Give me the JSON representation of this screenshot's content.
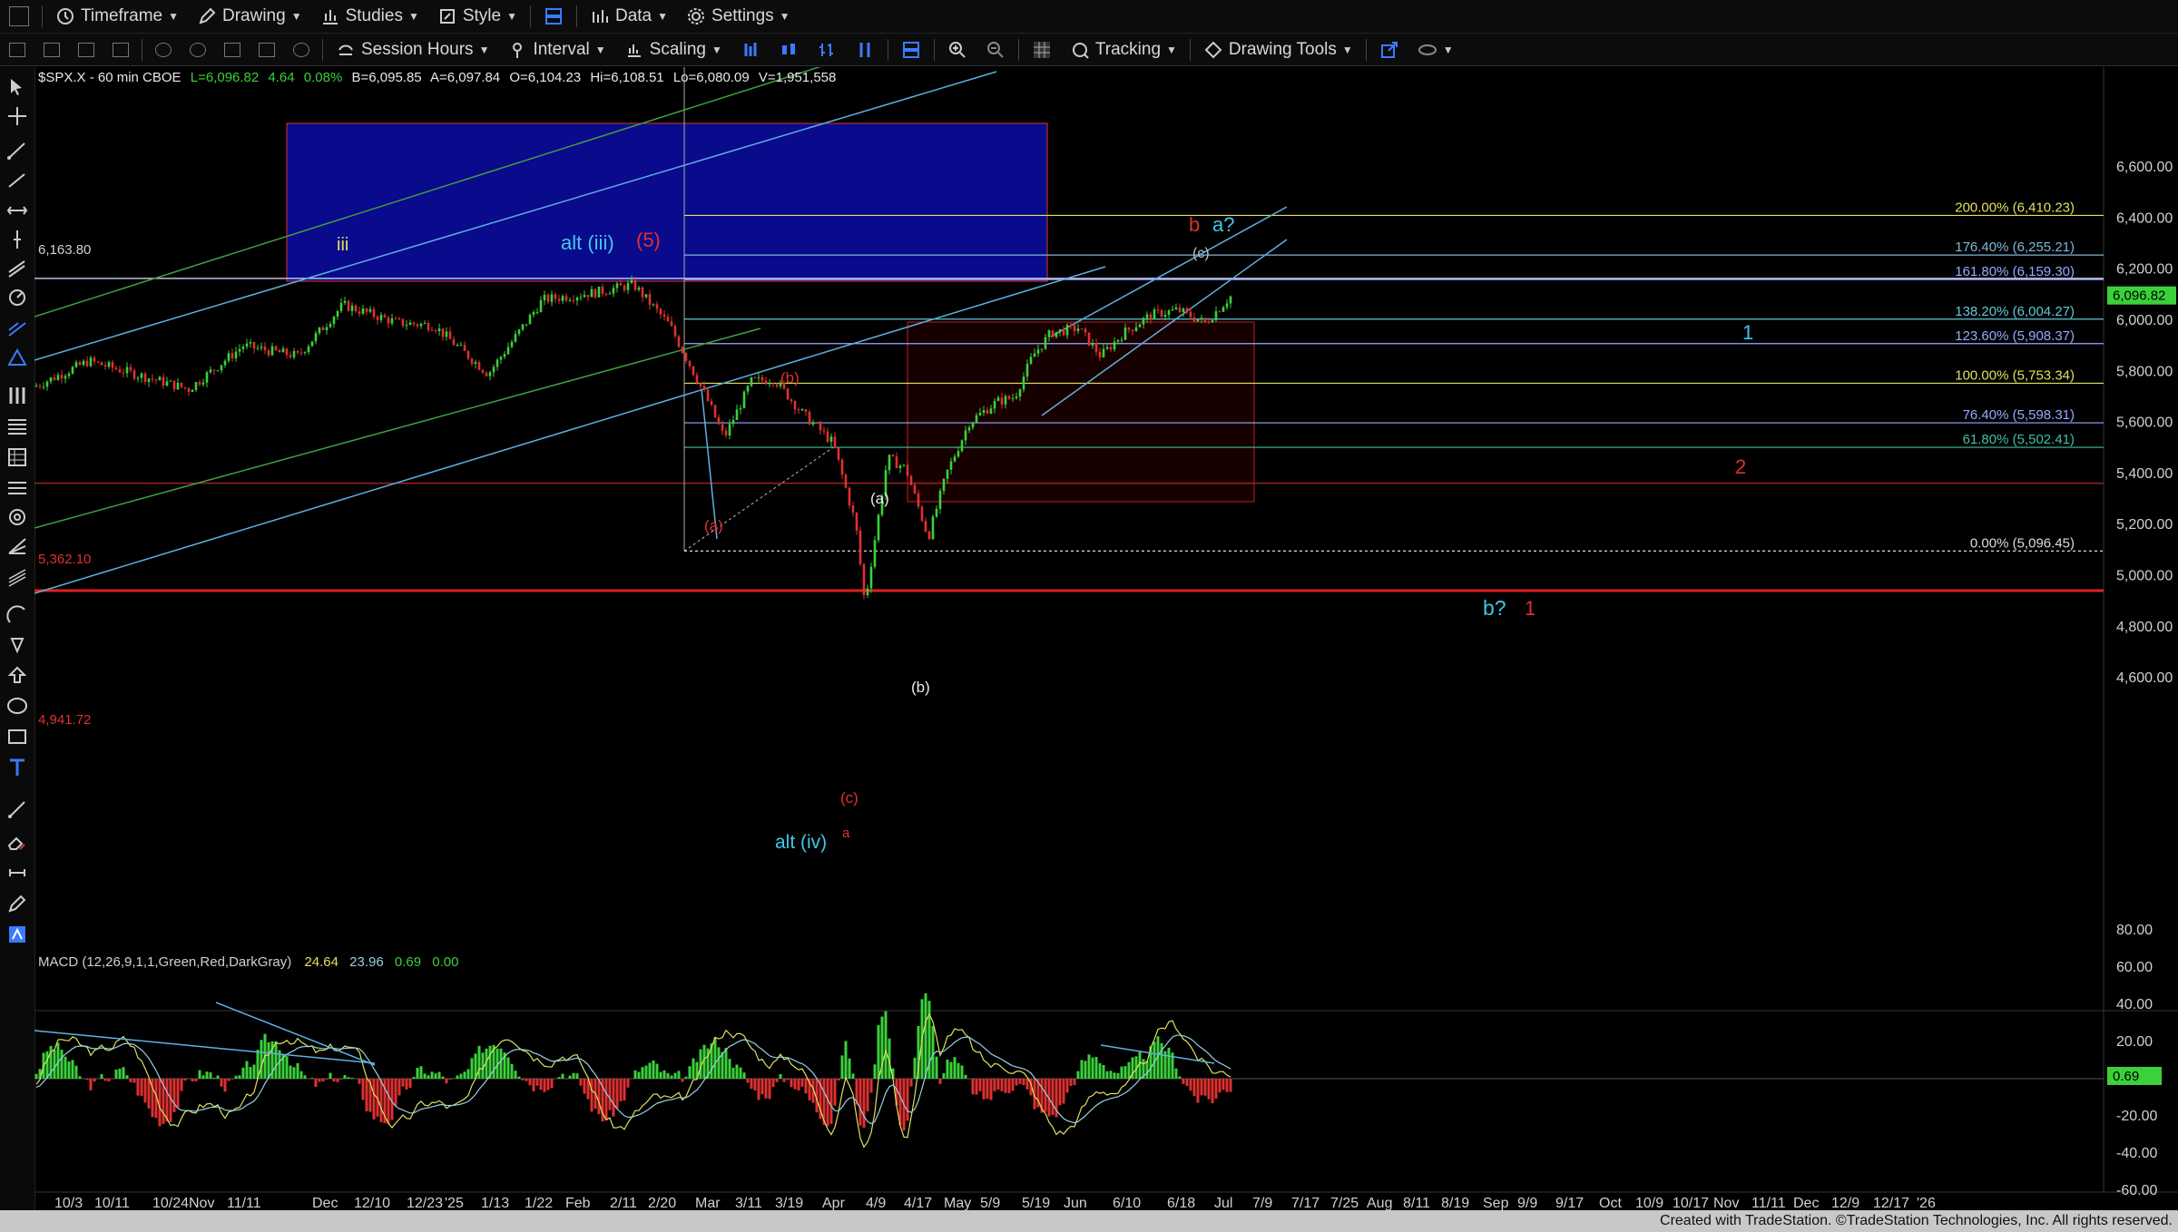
{
  "toolbar": {
    "timeframe": "Timeframe",
    "drawing": "Drawing",
    "studies": "Studies",
    "style": "Style",
    "data": "Data",
    "settings": "Settings",
    "session_hours": "Session Hours",
    "interval": "Interval",
    "scaling": "Scaling",
    "tracking": "Tracking",
    "drawing_tools": "Drawing Tools"
  },
  "chart_header": {
    "symbol": "$SPX.X - 60 min  CBOE",
    "last": "L=6,096.82",
    "change": "4.64",
    "change_pct": "0.08%",
    "bid": "B=6,095.85",
    "ask": "A=6,097.84",
    "open": "O=6,104.23",
    "high": "Hi=6,108.51",
    "low": "Lo=6,080.09",
    "volume": "V=1,951,558"
  },
  "price_axis": {
    "ticks": [
      "6,600.00",
      "6,400.00",
      "6,200.00",
      "6,000.00",
      "5,800.00",
      "5,600.00",
      "5,400.00",
      "5,200.00",
      "5,000.00",
      "4,800.00",
      "4,600.00"
    ],
    "last_price": "6,096.82"
  },
  "level_labels": {
    "level_6163": "6,163.80",
    "level_5362": "5,362.10",
    "level_4941": "4,941.72"
  },
  "fib_levels": [
    {
      "label": "200.00% (6,410.23)",
      "price": 6410.23,
      "color": "#e0e060"
    },
    {
      "label": "176.40% (6,255.21)",
      "price": 6255.21,
      "color": "#7fb8d8"
    },
    {
      "label": "161.80% (6,159.30)",
      "price": 6159.3,
      "color": "#9aa8ff"
    },
    {
      "label": "138.20% (6,004.27)",
      "price": 6004.27,
      "color": "#5fc8d8"
    },
    {
      "label": "123.60% (5,908.37)",
      "price": 5908.37,
      "color": "#9aa8ff"
    },
    {
      "label": "100.00% (5,753.34)",
      "price": 5753.34,
      "color": "#e0e060"
    },
    {
      "label": "76.40% (5,598.31)",
      "price": 5598.31,
      "color": "#9aa8ff"
    },
    {
      "label": "61.80% (5,502.41)",
      "price": 5502.41,
      "color": "#40c0a0"
    },
    {
      "label": "0.00% (5,096.45)",
      "price": 5096.45,
      "color": "#dddddd"
    }
  ],
  "wave_labels": {
    "iii": "iii",
    "alt_iii": "alt (iii)",
    "five": "(5)",
    "a_red": "(a)",
    "b_red": "(b)",
    "a_white": "(a)",
    "b_white": "(b)",
    "c_red": "(c)",
    "c_top": "(c)",
    "a_small": "a",
    "alt_iv": "alt (iv)",
    "b_top": "b",
    "a_q": "a?",
    "one_cyan": "1",
    "two_red": "2",
    "b_q": "b?",
    "one_red": "1"
  },
  "time_axis": [
    "10/3",
    "10/11",
    "10/24",
    "Nov",
    "11/11",
    "Dec",
    "12/10",
    "12/23",
    "'25",
    "1/13",
    "1/22",
    "Feb",
    "2/11",
    "2/20",
    "Mar",
    "3/11",
    "3/19",
    "Apr",
    "4/9",
    "4/17",
    "May",
    "5/9",
    "5/19",
    "Jun",
    "6/10",
    "6/18",
    "Jul",
    "7/9",
    "7/17",
    "7/25",
    "Aug",
    "8/11",
    "8/19",
    "Sep",
    "9/9",
    "9/17",
    "Oct",
    "10/9",
    "10/17",
    "Nov",
    "11/11",
    "Dec",
    "12/9",
    "12/17",
    "'26"
  ],
  "macd": {
    "label": "MACD (12,26,9,1,1,Green,Red,DarkGray)",
    "v1": "24.64",
    "v2": "23.96",
    "v3": "0.69",
    "v4": "0.00",
    "ticks": [
      "80.00",
      "60.00",
      "40.00",
      "20.00",
      "-20.00",
      "-40.00",
      "-60.00"
    ],
    "current": "0.69"
  },
  "footer": "Created with TradeStation. ©TradeStation Technologies, Inc. All rights reserved.",
  "colors": {
    "bull": "#3ad13a",
    "bear": "#e03030",
    "blue_box": "#0a0a8c",
    "red_level": "#e02020",
    "cyan_label": "#40c8e8"
  }
}
